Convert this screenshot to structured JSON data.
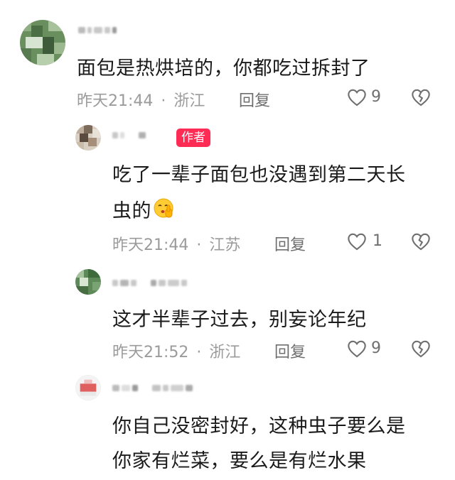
{
  "comments": [
    {
      "text": "面包是热烘培的，你都吃过拆封了",
      "time": "昨天21:44",
      "location": "浙江",
      "reply": "回复",
      "likes": "9"
    },
    {
      "badge": "作者",
      "text_line1": "吃了一辈子面包也没遇到第二天长",
      "text_line2": "虫的",
      "time": "昨天21:44",
      "location": "江苏",
      "reply": "回复",
      "likes": "1",
      "emoji": "shushing-face"
    },
    {
      "text": "这才半辈子过去，别妄论年纪",
      "time": "昨天21:52",
      "location": "浙江",
      "reply": "回复",
      "likes": "9"
    },
    {
      "text_line1": "你自己没密封好，这种虫子要么是",
      "text_line2": "你家有烂菜，要么是有烂水果"
    }
  ],
  "separator": "·",
  "colors": {
    "badge": "#fe2c55",
    "meta": "#9b9b9b",
    "text": "#1a1a1a"
  }
}
